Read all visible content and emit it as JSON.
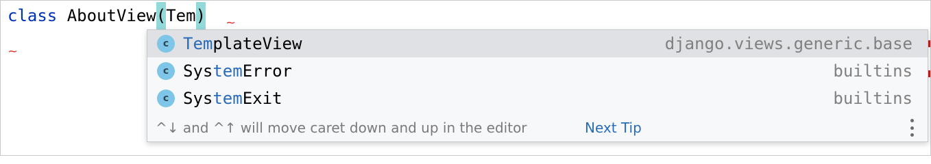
{
  "editor": {
    "keyword": "class",
    "class_name": "AboutView",
    "open_paren": "(",
    "typed": "Tem",
    "close_paren": ")",
    "error_mark": "~"
  },
  "completion": {
    "items": [
      {
        "match": "Tem",
        "rest": "plateView",
        "prefix": "",
        "location": "django.views.generic.base",
        "icon": "class-icon",
        "icon_letter": "c",
        "selected": true
      },
      {
        "prefix": "Sys",
        "match": "tem",
        "rest": "Error",
        "location": "builtins",
        "icon": "class-icon",
        "icon_letter": "c",
        "selected": false
      },
      {
        "prefix": "Sys",
        "match": "tem",
        "rest": "Exit",
        "location": "builtins",
        "icon": "class-icon",
        "icon_letter": "c",
        "selected": false
      }
    ],
    "tip_text": "^↓ and ^↑ will move caret down and up in the editor",
    "next_tip_label": "Next Tip"
  },
  "colors": {
    "keyword": "#0033b3",
    "match_highlight": "#2a6bb8",
    "paren_highlight": "#93d9d9",
    "error": "#e0312a",
    "icon_bg": "#7fc5e7"
  }
}
